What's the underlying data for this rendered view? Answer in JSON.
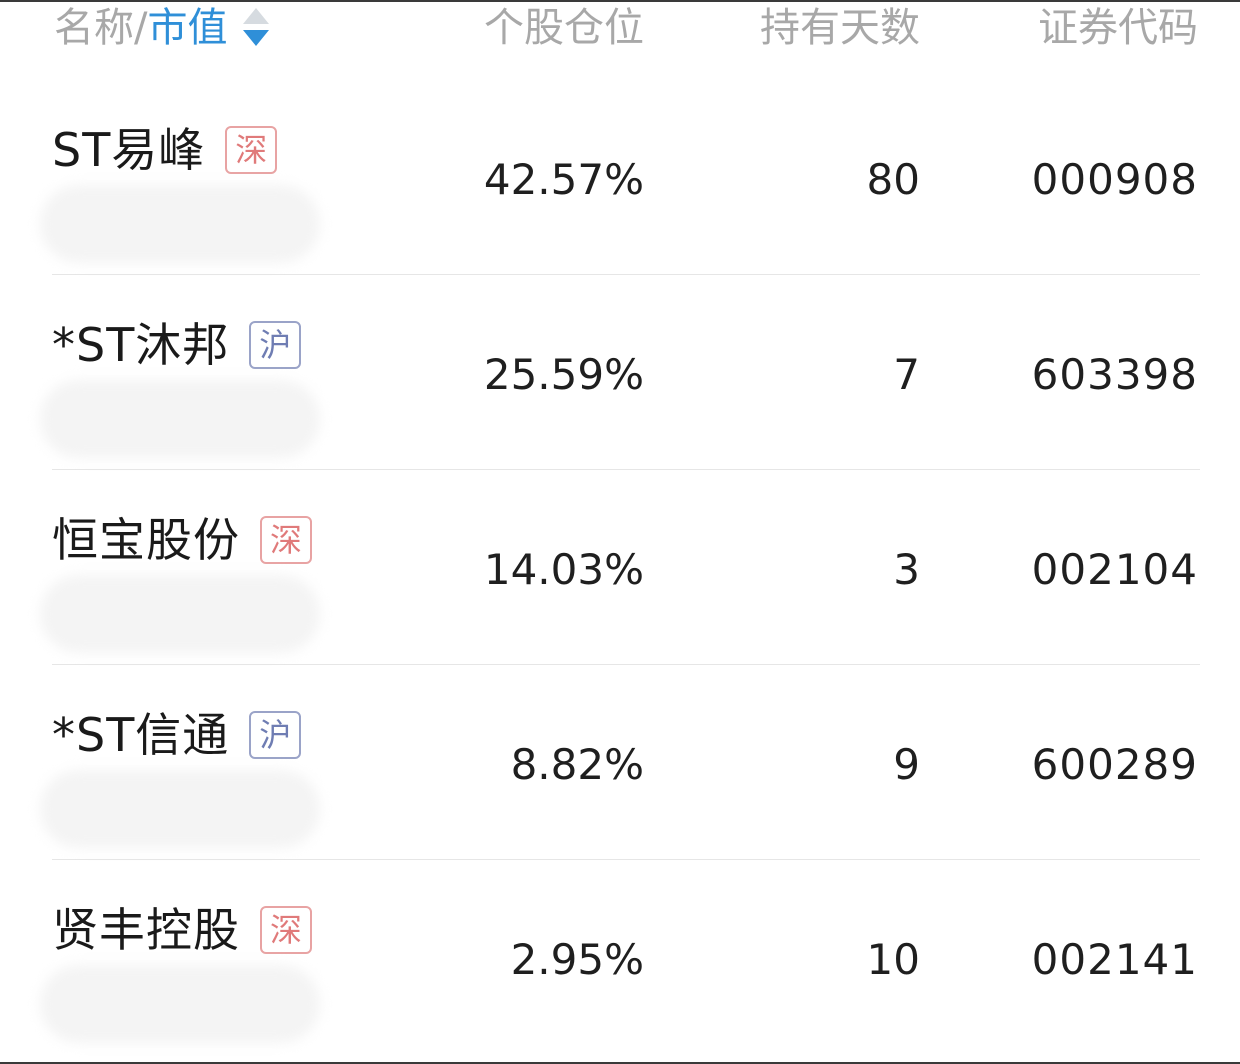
{
  "header": {
    "name_label": "名称/",
    "market_value_label": "市值",
    "position_label": "个股仓位",
    "hold_days_label": "持有天数",
    "code_label": "证券代码",
    "sort_icon": "sort-desc-icon",
    "accent_color": "#2f8fd8"
  },
  "rows": [
    {
      "name": "ST易峰",
      "market": "深",
      "position": "42.57%",
      "days": "80",
      "code": "000908"
    },
    {
      "name": "*ST沐邦",
      "market": "沪",
      "position": "25.59%",
      "days": "7",
      "code": "603398"
    },
    {
      "name": "恒宝股份",
      "market": "深",
      "position": "14.03%",
      "days": "3",
      "code": "002104"
    },
    {
      "name": "*ST信通",
      "market": "沪",
      "position": "8.82%",
      "days": "9",
      "code": "600289"
    },
    {
      "name": "贤丰控股",
      "market": "深",
      "position": "2.95%",
      "days": "10",
      "code": "002141"
    }
  ],
  "colors": {
    "sz_tag": "#e07a7a",
    "sh_tag": "#6f7db3",
    "header_text": "#a8a8a8"
  }
}
